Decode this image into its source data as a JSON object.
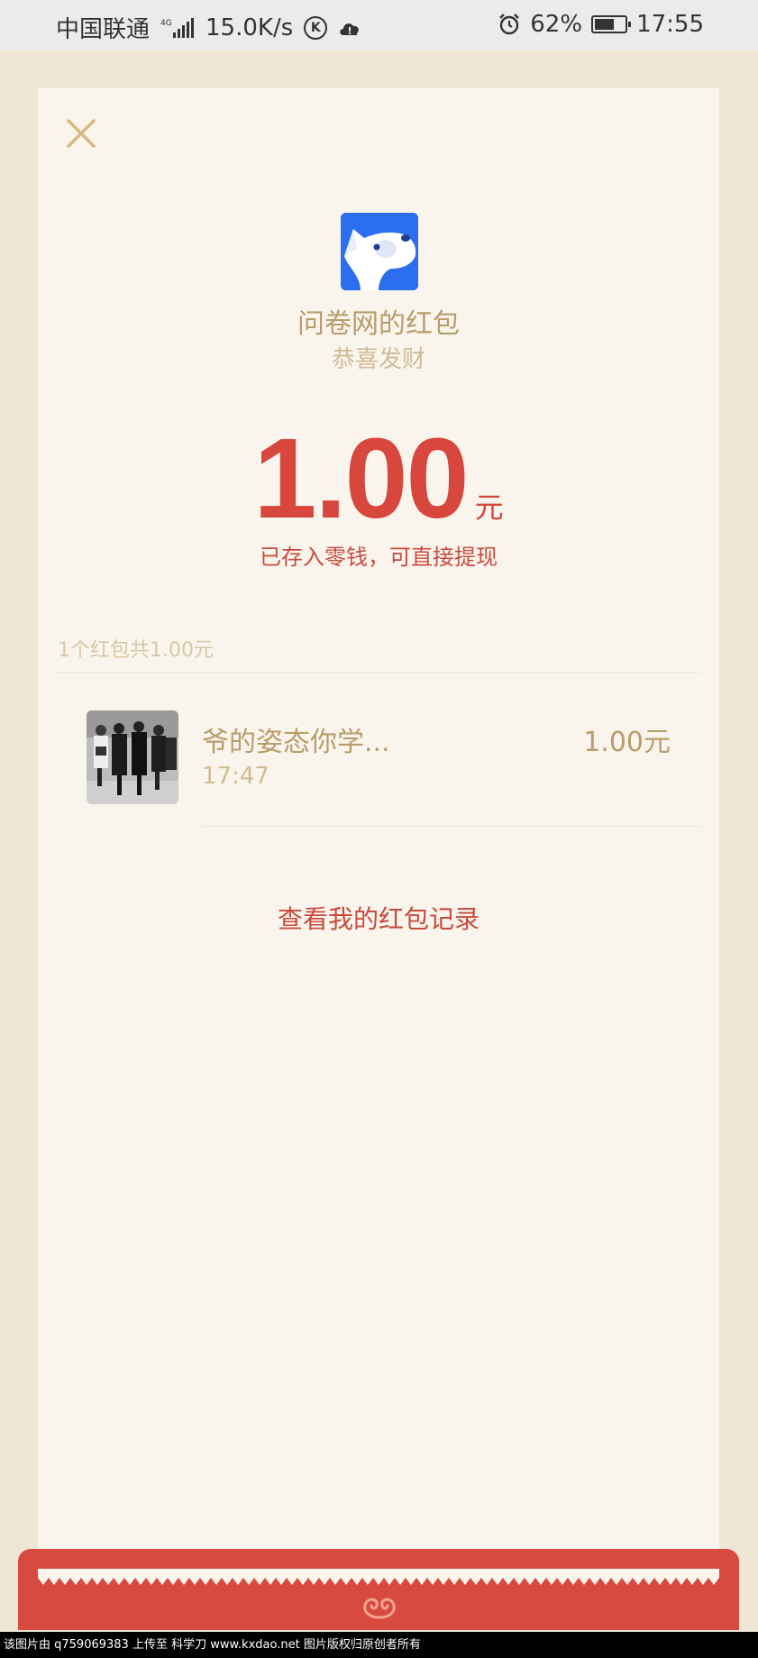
{
  "status_bar": {
    "carrier": "中国联通",
    "network": "4G",
    "speed": "15.0K/s",
    "battery": "62%",
    "time": "17:55"
  },
  "red_packet": {
    "sender_title": "问卷网的红包",
    "blessing": "恭喜发财",
    "amount": "1.00",
    "unit": "元",
    "note": "已存入零钱，可直接提现",
    "summary": "1个红包共1.00元",
    "records": [
      {
        "name": "爷的姿态你学...",
        "time": "17:47",
        "amount": "1.00元"
      }
    ],
    "history_link": "查看我的红包记录"
  },
  "footer": {
    "watermark": "该图片由 q759069383 上传至 科学刀 www.kxdao.net 图片版权归原创者所有"
  },
  "colors": {
    "accent_red": "#d7473d",
    "gold_text": "#b99c6b",
    "card_bg": "#faf5ec",
    "page_bg": "#efe6d5"
  }
}
